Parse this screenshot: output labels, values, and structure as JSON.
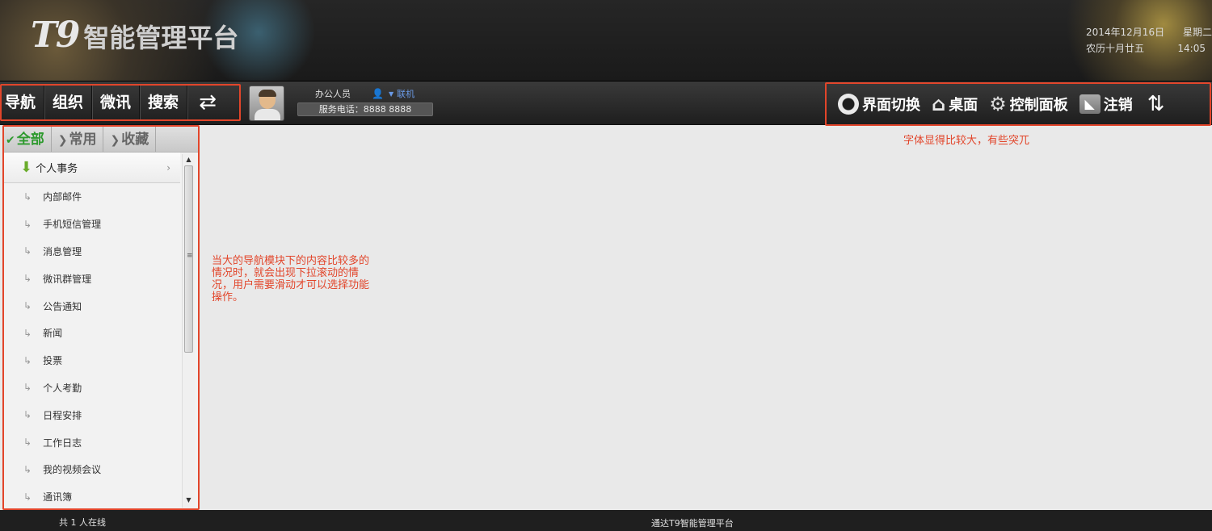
{
  "header": {
    "logo_t9": "T9",
    "logo_name": "智能管理平台",
    "date": "2014年12月16日",
    "weekday": "星期二",
    "lunar": "农历十月廿五",
    "time": "14:05"
  },
  "toolbar": {
    "nav_tabs": [
      "导航",
      "组织",
      "微讯",
      "搜索"
    ],
    "user_role": "办公人员",
    "user_status": "联机",
    "service_phone": "服务电话：8888 8888",
    "tools": {
      "switch": "界面切换",
      "desktop": "桌面",
      "control_panel": "控制面板",
      "logout": "注销"
    }
  },
  "notes": {
    "top": "字体显得比较大，有些突兀",
    "side": "当大的导航模块下的内容比较多的情况时，就会出现下拉滚动的情况，用户需要滑动才可以选择功能操作。"
  },
  "sidebar": {
    "tabs": [
      "全部",
      "常用",
      "收藏"
    ],
    "group": "个人事务",
    "items": [
      "内部邮件",
      "手机短信管理",
      "消息管理",
      "微讯群管理",
      "公告通知",
      "新闻",
      "投票",
      "个人考勤",
      "日程安排",
      "工作日志",
      "我的视频会议",
      "通讯簿"
    ]
  },
  "footer": {
    "online_count": "共 1 人在线",
    "brand": "通达T9智能管理平台"
  },
  "colors": {
    "annotation": "#e2452a",
    "active_tab": "#2e9a2e"
  }
}
